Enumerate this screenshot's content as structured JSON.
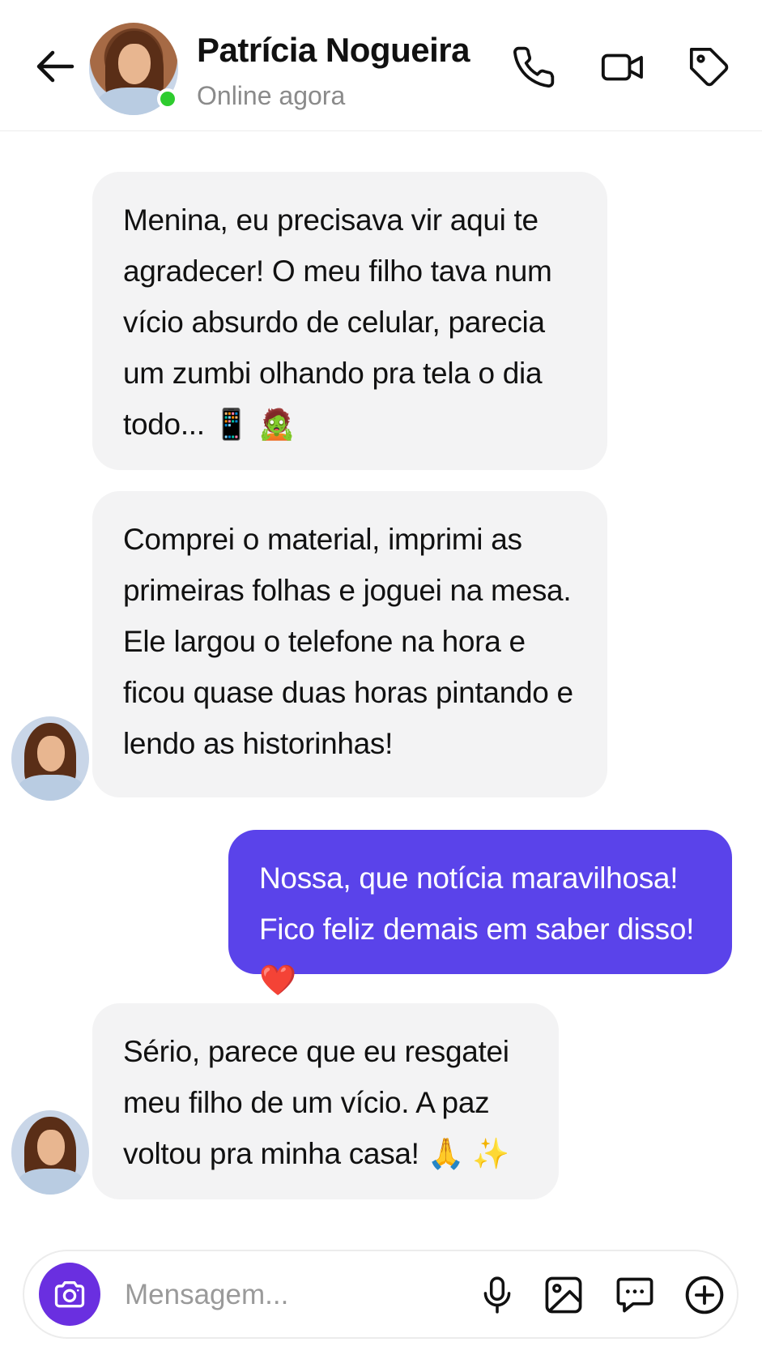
{
  "header": {
    "contact_name": "Patrícia Nogueira",
    "status": "Online agora",
    "online_color": "#2ecc2e",
    "icons": [
      "back-arrow-icon",
      "phone-icon",
      "video-camera-icon",
      "tag-icon"
    ]
  },
  "messages": [
    {
      "direction": "incoming",
      "text": "Menina, eu precisava vir aqui te agradecer! O meu filho tava num vício absurdo de celular, parecia um zumbi olhando pra tela o dia todo... 📱 🧟"
    },
    {
      "direction": "incoming",
      "text": "Comprei o material, imprimi as primeiras folhas e joguei na mesa. Ele largou o telefone na hora e ficou quase duas horas pintando e lendo as historinhas!"
    },
    {
      "direction": "outgoing",
      "text": "Nossa, que notícia maravilhosa! Fico feliz demais em saber disso! ❤️"
    },
    {
      "direction": "incoming",
      "text": "Sério, parece que eu resgatei meu filho de um vício. A paz voltou pra minha casa! 🙏 ✨"
    }
  ],
  "composer": {
    "placeholder": "Mensagem...",
    "value": "",
    "accent_color": "#6a2fe0",
    "icons": [
      "camera-icon",
      "microphone-icon",
      "image-icon",
      "chat-bubble-icon",
      "plus-circle-icon"
    ]
  },
  "colors": {
    "incoming_bubble": "#f3f3f4",
    "outgoing_bubble": "#5a43ea"
  }
}
